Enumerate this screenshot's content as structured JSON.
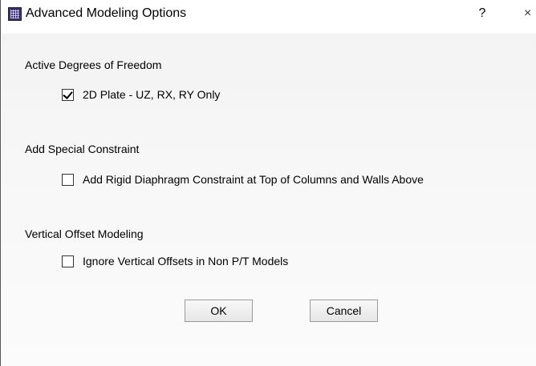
{
  "window": {
    "title": "Advanced Modeling Options",
    "help_label": "?",
    "close_label": "×"
  },
  "groups": {
    "dof": {
      "title": "Active Degrees of Freedom",
      "option_label": "2D Plate - UZ, RX, RY Only",
      "checked": true
    },
    "constraint": {
      "title": "Add Special Constraint",
      "option_label": "Add Rigid Diaphragm Constraint at Top of Columns and Walls Above",
      "checked": false
    },
    "offset": {
      "title": "Vertical Offset Modeling",
      "option_label": "Ignore Vertical Offsets in Non P/T Models",
      "checked": false
    }
  },
  "buttons": {
    "ok_label": "OK",
    "cancel_label": "Cancel"
  }
}
